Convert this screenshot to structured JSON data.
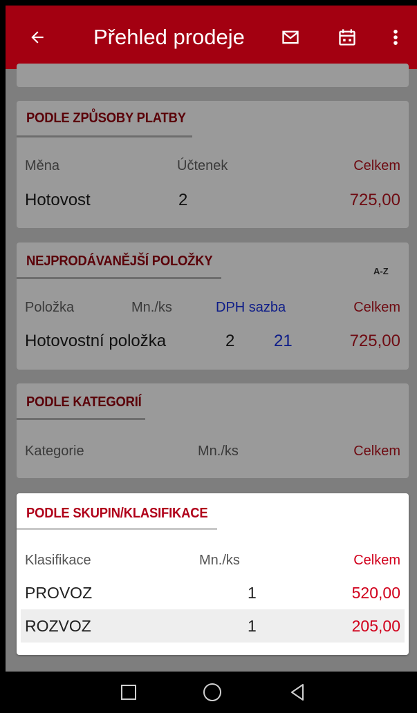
{
  "appbar": {
    "title": "Přehled prodeje",
    "back_icon": "arrow-left-icon",
    "mail_icon": "mail-icon",
    "calendar_icon": "calendar-icon",
    "more_icon": "more-vert-icon",
    "color": "#a30011"
  },
  "payment": {
    "title": "PODLE ZPŮSOBY PLATBY",
    "headers": {
      "currency": "Měna",
      "receipts": "Účtenek",
      "total": "Celkem"
    },
    "rows": [
      {
        "name": "Hotovost",
        "count": "2",
        "total": "725,00"
      }
    ]
  },
  "bestsellers": {
    "title": "NEJPRODÁVANĚJŠÍ POLOŽKY",
    "sort_label": "A-Z",
    "headers": {
      "item": "Položka",
      "qty": "Mn./ks",
      "vat": "DPH sazba",
      "total": "Celkem"
    },
    "rows": [
      {
        "name": "Hotovostní položka",
        "qty": "2",
        "vat": "21",
        "total": "725,00"
      }
    ]
  },
  "categories": {
    "title": "PODLE KATEGORIÍ",
    "headers": {
      "category": "Kategorie",
      "qty": "Mn./ks",
      "total": "Celkem"
    },
    "rows": []
  },
  "groups": {
    "title": "PODLE SKUPIN/KLASIFIKACE",
    "headers": {
      "classification": "Klasifikace",
      "qty": "Mn./ks",
      "total": "Celkem"
    },
    "rows": [
      {
        "name": "PROVOZ",
        "qty": "1",
        "total": "520,00"
      },
      {
        "name": "ROZVOZ",
        "qty": "1",
        "total": "205,00"
      }
    ]
  },
  "navbar": {
    "square_icon": "recents-icon",
    "circle_icon": "home-icon",
    "triangle_icon": "back-nav-icon"
  }
}
